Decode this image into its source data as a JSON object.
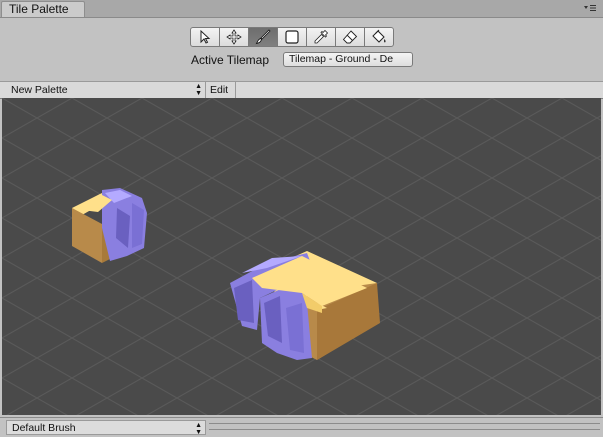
{
  "window": {
    "tab_title": "Tile Palette"
  },
  "toolbar": {
    "tools": [
      {
        "name": "select",
        "icon": "arrow-icon",
        "active": false
      },
      {
        "name": "move",
        "icon": "move-icon",
        "active": false
      },
      {
        "name": "paint",
        "icon": "brush-icon",
        "active": true
      },
      {
        "name": "box-fill",
        "icon": "box-icon",
        "active": false
      },
      {
        "name": "picker",
        "icon": "eyedropper-icon",
        "active": false
      },
      {
        "name": "erase",
        "icon": "eraser-icon",
        "active": false
      },
      {
        "name": "fill",
        "icon": "bucket-icon",
        "active": false
      }
    ]
  },
  "active_tilemap": {
    "label": "Active Tilemap",
    "value": "Tilemap - Ground - De"
  },
  "palette_bar": {
    "palette_name": "New Palette",
    "edit_label": "Edit"
  },
  "bottom_bar": {
    "brush_name": "Default Brush"
  },
  "colors": {
    "viewport_bg": "#4a4a4a",
    "grid": "#5a5a5a",
    "tile_top": "#ffe08a",
    "tile_side": "#b88a4a",
    "tile_stone": "#8a7fe0"
  }
}
